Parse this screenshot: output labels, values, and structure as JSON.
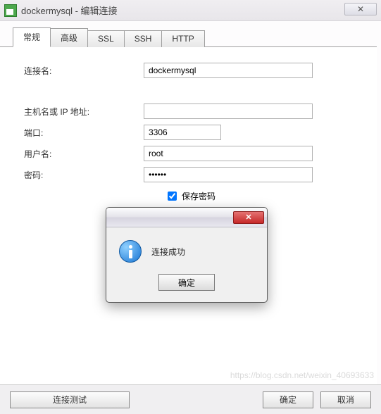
{
  "window": {
    "title": "dockermysql - 编辑连接",
    "close_glyph": "✕"
  },
  "tabs": [
    {
      "label": "常规",
      "active": true
    },
    {
      "label": "高级",
      "active": false
    },
    {
      "label": "SSL",
      "active": false
    },
    {
      "label": "SSH",
      "active": false
    },
    {
      "label": "HTTP",
      "active": false
    }
  ],
  "form": {
    "connection_name_label": "连接名:",
    "connection_name_value": "dockermysql",
    "host_label": "主机名或 IP 地址:",
    "host_value": "",
    "port_label": "端口:",
    "port_value": "3306",
    "user_label": "用户名:",
    "user_value": "root",
    "password_label": "密码:",
    "password_value": "••••••",
    "save_password_label": "保存密码",
    "save_password_checked": true
  },
  "buttons": {
    "test_connection": "连接测试",
    "ok": "确定",
    "cancel": "取消"
  },
  "dialog": {
    "close_glyph": "✕",
    "message": "连接成功",
    "ok": "确定"
  },
  "watermark": "https://blog.csdn.net/weixin_40693633"
}
